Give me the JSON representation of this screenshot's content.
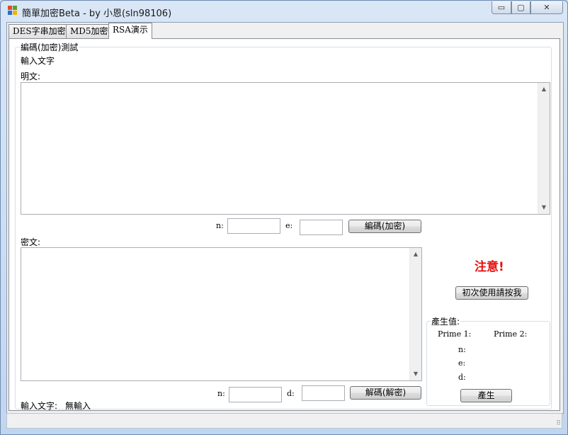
{
  "window": {
    "title": "簡單加密Beta - by 小恩(sln98106)",
    "controls": {
      "minimize": "▭",
      "maximize": "▢",
      "close": "✕"
    }
  },
  "tabs": [
    {
      "label": "DES字串加密",
      "active": false
    },
    {
      "label": "MD5加密",
      "active": false
    },
    {
      "label": "RSA演示",
      "active": true
    }
  ],
  "encode_group": {
    "caption": "編碼(加密)測試",
    "input_text_label": "輸入文字",
    "plaintext_label": "明文:",
    "plaintext_value": "",
    "n_label": "n:",
    "n_value": "",
    "e_label": "e:",
    "e_value": "",
    "encode_button": "編碼(加密)",
    "ciphertext_label": "密文:",
    "ciphertext_value": "",
    "n2_label": "n:",
    "n2_value": "",
    "d_label": "d:",
    "d_value": "",
    "decode_button": "解碼(解密)",
    "status_label": "輸入文字:",
    "status_value": "無輸入"
  },
  "notice": {
    "warning": "注意!",
    "first_use_button": "初次使用請按我"
  },
  "generate_group": {
    "caption": "產生值:",
    "prime1_label": "Prime 1:",
    "prime2_label": "Prime 2:",
    "n_label": "n:",
    "e_label": "e:",
    "d_label": "d:",
    "generate_button": "產生"
  },
  "scroll_icons": {
    "up": "▲",
    "down": "▼"
  },
  "colors": {
    "warning": "#e81010"
  }
}
